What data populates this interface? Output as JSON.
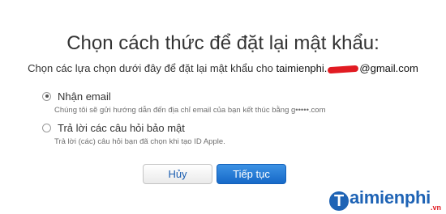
{
  "header": {
    "title": "Chọn cách thức để đặt lại mật khẩu:",
    "subtitle_prefix": "Chọn các lựa chọn dưới đây để đặt lại mật khẩu cho",
    "account_start": "taimienphi.",
    "account_end": "@gmail.com"
  },
  "options": [
    {
      "label": "Nhận email",
      "description": "Chúng tôi sẽ gửi hướng dẫn đến địa chỉ email của bạn kết thúc bằng g•••••.com",
      "selected": true
    },
    {
      "label": "Trả lời các câu hỏi bảo mật",
      "description": "Trả lời (các) câu hỏi bạn đã chọn khi tạo ID Apple.",
      "selected": false
    }
  ],
  "buttons": {
    "cancel_label": "Hủy",
    "continue_label": "Tiếp tục"
  },
  "watermark": {
    "logo_letter": "T",
    "logo_text": "aimienphi",
    "logo_suffix": ".vn"
  },
  "colors": {
    "accent": "#1669c8",
    "redaction": "#e11b22",
    "logo_blue": "#1e63b5"
  }
}
